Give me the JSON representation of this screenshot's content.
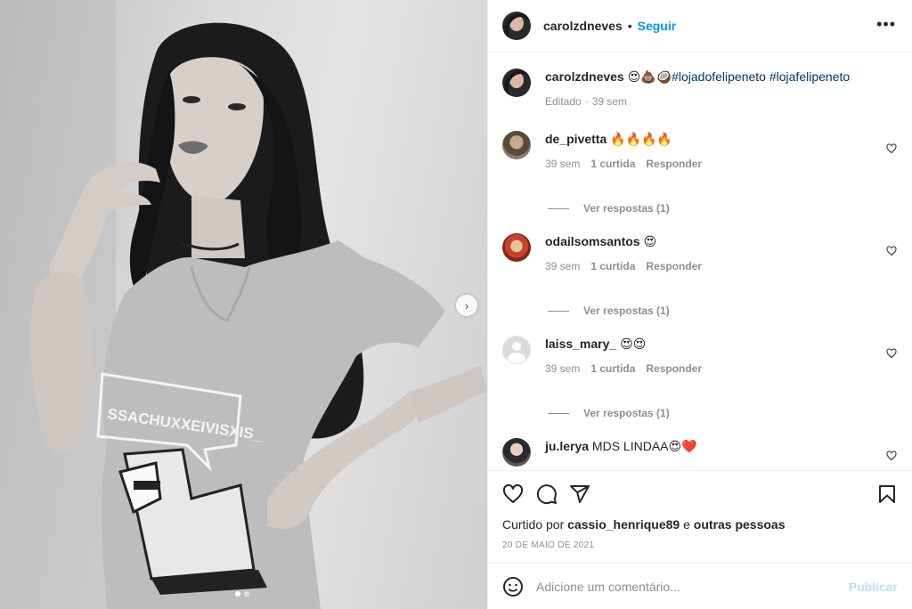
{
  "post": {
    "author": "carolzdneves",
    "follow_label": "Seguir",
    "separator": "•",
    "more_label": "•••",
    "carousel_next": "›"
  },
  "caption": {
    "username": "carolzdneves",
    "emojis": "😍💩🥥",
    "hashtags": [
      "#lojadofelipeneto",
      "#lojafelipeneto"
    ],
    "edited": "Editado",
    "separator": "·",
    "age": "39 sem"
  },
  "comments": [
    {
      "username": "de_pivetta",
      "text": "🔥🔥🔥🔥",
      "age": "39 sem",
      "likes": "1 curtida",
      "reply_label": "Responder",
      "replies_label": "Ver respostas (1)"
    },
    {
      "username": "odailsomsantos",
      "text": "😍",
      "age": "39 sem",
      "likes": "1 curtida",
      "reply_label": "Responder",
      "replies_label": "Ver respostas (1)"
    },
    {
      "username": "laiss_mary_",
      "text": "😍😍",
      "age": "39 sem",
      "likes": "1 curtida",
      "reply_label": "Responder",
      "replies_label": "Ver respostas (1)"
    },
    {
      "username": "ju.lerya",
      "text": "MDS LINDAA😍❤️"
    }
  ],
  "likes": {
    "prefix": "Curtido por",
    "user": "cassio_henrique89",
    "conjunction": "e",
    "others": "outras pessoas"
  },
  "date": "20 DE MAIO DE 2021",
  "add_comment": {
    "placeholder": "Adicione um comentário...",
    "publish_label": "Publicar"
  },
  "icons": {
    "heart": "heart-icon",
    "comment": "comment-icon",
    "share": "share-icon",
    "save": "bookmark-icon",
    "emoji": "emoji-icon"
  },
  "colors": {
    "link": "#0095f6",
    "hashtag": "#00376b",
    "muted": "#8e8e8e",
    "publish_disabled": "#b2dffc"
  },
  "carousel": {
    "slides": 2,
    "current": 1
  }
}
